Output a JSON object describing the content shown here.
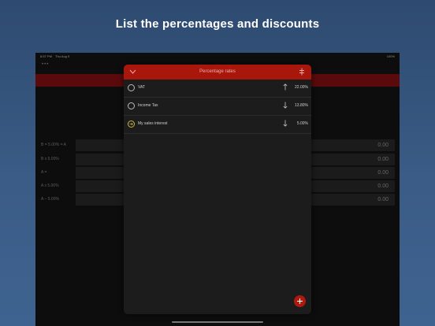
{
  "headline": "List the percentages and discounts",
  "statusbar": {
    "time": "8:57 PM",
    "date": "Thu Aug 5",
    "battery": "100%"
  },
  "background_rows": [
    {
      "label": "B = 5.00% = A",
      "value": "0.00"
    },
    {
      "label": "B x 5.00%",
      "value": "0.00"
    },
    {
      "label": "A =",
      "value": "0.00"
    },
    {
      "label": "A x 5.00%",
      "value": "0.00"
    },
    {
      "label": "A − 5.00%",
      "value": "0.00"
    }
  ],
  "modal": {
    "title": "Percentage rates",
    "rates": [
      {
        "name": "VAT",
        "direction": "up",
        "value": "22.00%",
        "selected": false
      },
      {
        "name": "Income Tax",
        "direction": "down",
        "value": "13.80%",
        "selected": false
      },
      {
        "name": "My sales interest",
        "direction": "down",
        "value": "5.00%",
        "selected": true
      }
    ],
    "add_button_icon": "plus-icon"
  },
  "colors": {
    "accent_red": "#a8160c",
    "selected_ring": "#c8b34a"
  }
}
